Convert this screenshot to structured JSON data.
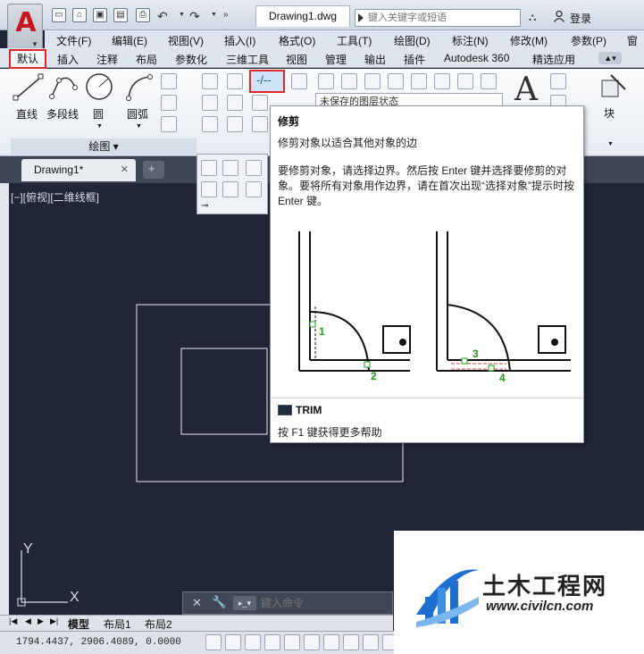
{
  "title_bar": {
    "document_tab": "Drawing1.dwg",
    "search_placeholder": "键入关键字或短语",
    "login": "登录"
  },
  "menu": [
    "文件(F)",
    "编辑(E)",
    "视图(V)",
    "插入(I)",
    "格式(O)",
    "工具(T)",
    "绘图(D)",
    "标注(N)",
    "修改(M)",
    "参数(P)",
    "窗口"
  ],
  "ribbon_tabs": [
    "默认",
    "插入",
    "注释",
    "布局",
    "参数化",
    "三维工具",
    "视图",
    "管理",
    "输出",
    "插件",
    "Autodesk 360",
    "精选应用"
  ],
  "ribbon": {
    "draw_buttons": [
      "直线",
      "多段线",
      "圆",
      "圆弧"
    ],
    "draw_panel_title": "绘图",
    "layer_state": "未保存的图层状态",
    "text_big": "A",
    "block_label": "块"
  },
  "file_tabs": {
    "active": "Drawing1*"
  },
  "canvas": {
    "view_label": "[−][俯视][二维线框]",
    "ucs_x": "X",
    "ucs_y": "Y"
  },
  "tooltip": {
    "title": "修剪",
    "description": "修剪对象以适合其他对象的边",
    "body": "要修剪对象，请选择边界。然后按 Enter 键并选择要修剪的对象。要将所有对象用作边界，请在首次出现“选择对象”提示时按 Enter 键。",
    "labels": [
      "1",
      "2",
      "3",
      "4"
    ],
    "command": "TRIM",
    "help": "按 F1 键获得更多帮助"
  },
  "command_line": {
    "placeholder": "键入命令"
  },
  "layout_tabs": [
    "模型",
    "布局1",
    "布局2"
  ],
  "status": {
    "coords": "1794.4437, 2906.4089, 0.0000"
  },
  "watermark": {
    "name": "土木工程网",
    "url": "www.civilcn.com"
  },
  "colors": {
    "accent_red": "#e02828",
    "canvas_bg": "#202635",
    "label_green": "#1a9b1a"
  }
}
